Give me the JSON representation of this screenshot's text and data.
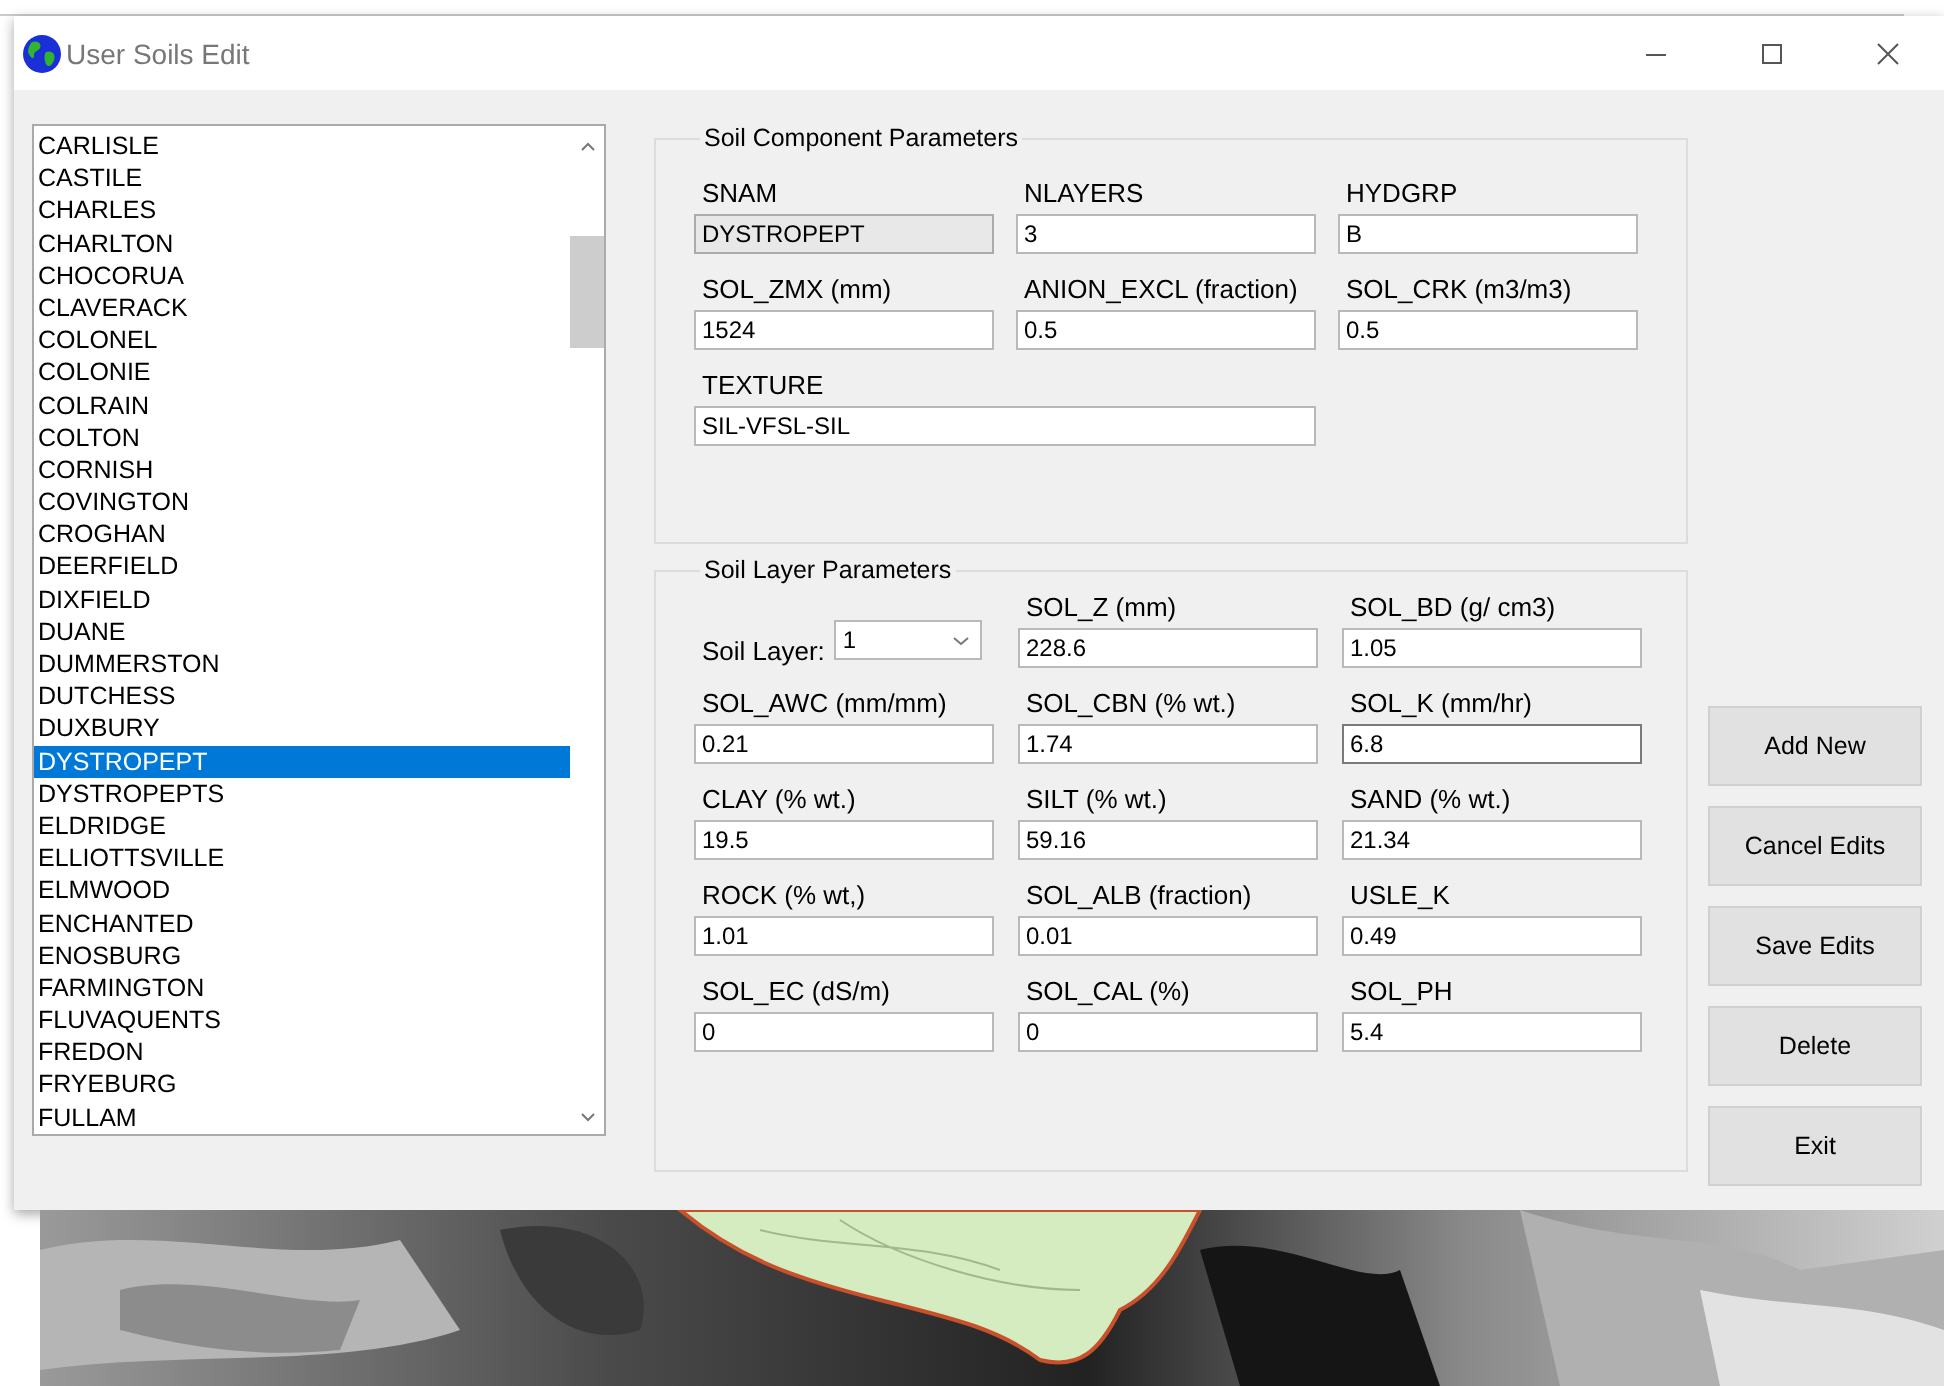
{
  "window": {
    "title": "User Soils Edit"
  },
  "soil_list": [
    {
      "name": "CARLISLE",
      "selected": false
    },
    {
      "name": "CASTILE",
      "selected": false
    },
    {
      "name": "CHARLES",
      "selected": false
    },
    {
      "name": "CHARLTON",
      "selected": false
    },
    {
      "name": "CHOCORUA",
      "selected": false
    },
    {
      "name": "CLAVERACK",
      "selected": false
    },
    {
      "name": "COLONEL",
      "selected": false
    },
    {
      "name": "COLONIE",
      "selected": false
    },
    {
      "name": "COLRAIN",
      "selected": false
    },
    {
      "name": "COLTON",
      "selected": false
    },
    {
      "name": "CORNISH",
      "selected": false
    },
    {
      "name": "COVINGTON",
      "selected": false
    },
    {
      "name": "CROGHAN",
      "selected": false
    },
    {
      "name": "DEERFIELD",
      "selected": false
    },
    {
      "name": "DIXFIELD",
      "selected": false
    },
    {
      "name": "DUANE",
      "selected": false
    },
    {
      "name": "DUMMERSTON",
      "selected": false
    },
    {
      "name": "DUTCHESS",
      "selected": false
    },
    {
      "name": "DUXBURY",
      "selected": false
    },
    {
      "name": "DYSTROPEPT",
      "selected": true
    },
    {
      "name": "DYSTROPEPTS",
      "selected": false
    },
    {
      "name": "ELDRIDGE",
      "selected": false
    },
    {
      "name": "ELLIOTTSVILLE",
      "selected": false
    },
    {
      "name": "ELMWOOD",
      "selected": false
    },
    {
      "name": "ENCHANTED",
      "selected": false
    },
    {
      "name": "ENOSBURG",
      "selected": false
    },
    {
      "name": "FARMINGTON",
      "selected": false
    },
    {
      "name": "FLUVAQUENTS",
      "selected": false
    },
    {
      "name": "FREDON",
      "selected": false
    },
    {
      "name": "FRYEBURG",
      "selected": false
    },
    {
      "name": "FULLAM",
      "selected": false
    }
  ],
  "component_parameters": {
    "title": "Soil Component Parameters",
    "fields": [
      {
        "label": "SNAM",
        "value": "DYSTROPEPT",
        "disabled": true
      },
      {
        "label": "NLAYERS",
        "value": "3",
        "disabled": false
      },
      {
        "label": "HYDGRP",
        "value": "B",
        "disabled": false
      },
      {
        "label": "SOL_ZMX (mm)",
        "value": "1524",
        "disabled": false
      },
      {
        "label": "ANION_EXCL (fraction)",
        "value": "0.5",
        "disabled": false
      },
      {
        "label": "SOL_CRK (m3/m3)",
        "value": "0.5",
        "disabled": false
      },
      {
        "label": "TEXTURE",
        "value": "SIL-VFSL-SIL",
        "disabled": false,
        "wide": true
      }
    ]
  },
  "layer_parameters": {
    "title": "Soil Layer Parameters",
    "soil_layer": {
      "label": "Soil Layer:",
      "value": "1"
    },
    "fields": [
      {
        "label": "SOL_Z (mm)",
        "value": "228.6",
        "focused": false
      },
      {
        "label": "SOL_BD (g/ cm3)",
        "value": "1.05",
        "focused": false
      },
      {
        "label": "SOL_AWC (mm/mm)",
        "value": "0.21",
        "focused": false
      },
      {
        "label": "SOL_CBN (% wt.)",
        "value": "1.74",
        "focused": false
      },
      {
        "label": "SOL_K (mm/hr)",
        "value": "6.8",
        "focused": true
      },
      {
        "label": "CLAY (% wt.)",
        "value": "19.5",
        "focused": false
      },
      {
        "label": "SILT (% wt.)",
        "value": "59.16",
        "focused": false
      },
      {
        "label": "SAND (% wt.)",
        "value": "21.34",
        "focused": false
      },
      {
        "label": "ROCK (% wt,)",
        "value": "1.01",
        "focused": false
      },
      {
        "label": "SOL_ALB (fraction)",
        "value": "0.01",
        "focused": false
      },
      {
        "label": "USLE_K",
        "value": "0.49",
        "focused": false
      },
      {
        "label": "SOL_EC (dS/m)",
        "value": "0",
        "focused": false
      },
      {
        "label": "SOL_CAL (%)",
        "value": "0",
        "focused": false
      },
      {
        "label": "SOL_PH",
        "value": "5.4",
        "focused": false
      }
    ]
  },
  "buttons": [
    "Add New",
    "Cancel Edits",
    "Save Edits",
    "Delete",
    "Exit"
  ]
}
